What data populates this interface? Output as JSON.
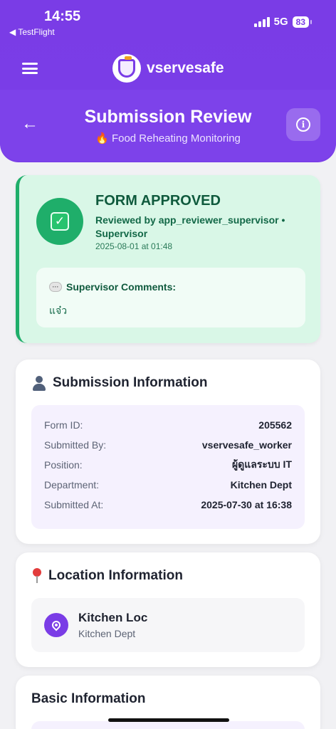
{
  "status_bar": {
    "time": "14:55",
    "back_app": "◀ TestFlight",
    "network": "5G",
    "battery": "83"
  },
  "header": {
    "brand": "vservesafe",
    "title": "Submission Review",
    "subtitle_emoji": "🔥",
    "subtitle": "Food Reheating Monitoring"
  },
  "approval": {
    "title": "FORM APPROVED",
    "reviewed_by": "Reviewed by app_reviewer_supervisor • Supervisor",
    "date": "2025-08-01 at 01:48",
    "comments_label": "Supervisor Comments:",
    "comment": "แจ๋ว"
  },
  "submission_info": {
    "title": "Submission Information",
    "rows": [
      {
        "label": "Form ID:",
        "value": "205562"
      },
      {
        "label": "Submitted By:",
        "value": "vservesafe_worker"
      },
      {
        "label": "Position:",
        "value": "ผู้ดูแลระบบ IT"
      },
      {
        "label": "Department:",
        "value": "Kitchen Dept"
      },
      {
        "label": "Submitted At:",
        "value": "2025-07-30 at 16:38"
      }
    ]
  },
  "location_info": {
    "title": "Location Information",
    "name": "Kitchen Loc",
    "department": "Kitchen Dept"
  },
  "basic_info": {
    "title": "Basic Information"
  },
  "colors": {
    "accent": "#7a3ce6",
    "approved_bg": "#d9f7e7",
    "approved_border": "#1fae6a"
  }
}
